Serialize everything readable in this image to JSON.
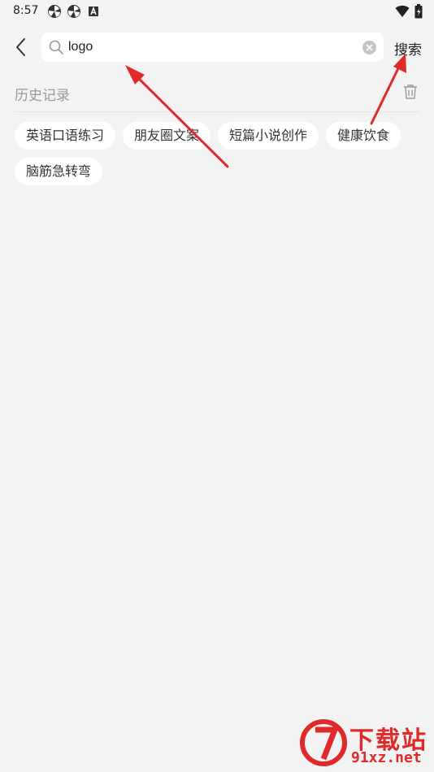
{
  "status_bar": {
    "time": "8:57",
    "left_icons": [
      "pinwheel-icon",
      "pinwheel-icon",
      "a-box-icon"
    ],
    "right_icons": [
      "wifi-icon",
      "battery-icon"
    ]
  },
  "search": {
    "query": "logo",
    "action_label": "搜索"
  },
  "history": {
    "title": "历史记录",
    "items": [
      {
        "label": "英语口语练习"
      },
      {
        "label": "朋友圈文案"
      },
      {
        "label": "短篇小说创作"
      },
      {
        "label": "健康饮食"
      },
      {
        "label": "脑筋急转弯"
      }
    ]
  },
  "watermark": {
    "brand": "下载站",
    "url": "91xz.net"
  },
  "colors": {
    "background": "#f3f3f3",
    "chip_bg": "#ffffff",
    "annotation_red": "#e02a2a",
    "muted_text": "#999999"
  }
}
